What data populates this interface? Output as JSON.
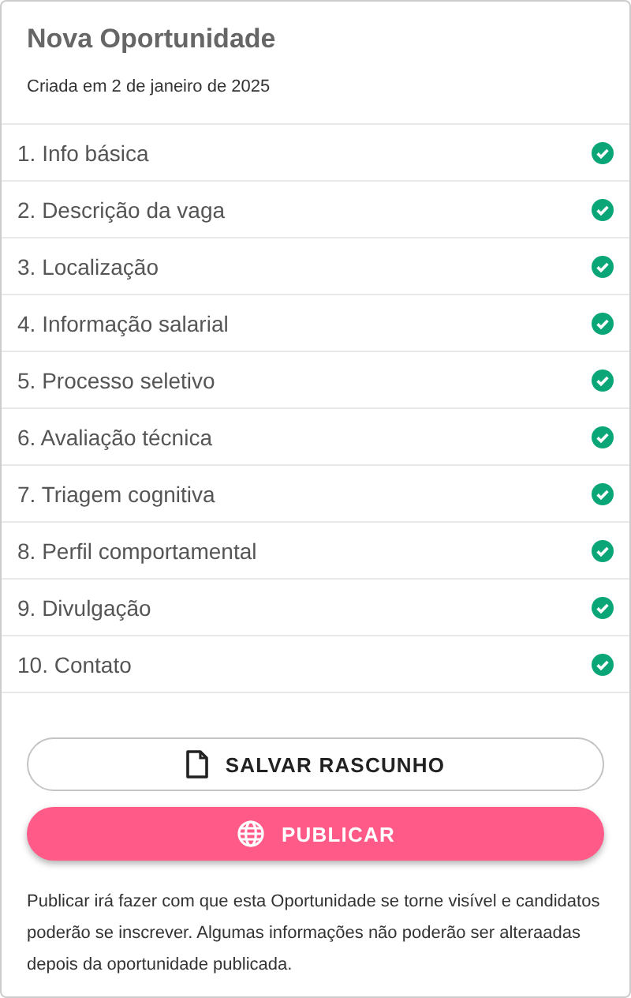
{
  "header": {
    "title": "Nova Oportunidade",
    "subtitle": "Criada em 2 de janeiro de 2025"
  },
  "steps": [
    {
      "label": "1. Info básica",
      "completed": true
    },
    {
      "label": "2. Descrição da vaga",
      "completed": true
    },
    {
      "label": "3. Localização",
      "completed": true
    },
    {
      "label": "4. Informação salarial",
      "completed": true
    },
    {
      "label": "5. Processo seletivo",
      "completed": true
    },
    {
      "label": "6. Avaliação técnica",
      "completed": true
    },
    {
      "label": "7. Triagem cognitiva",
      "completed": true
    },
    {
      "label": "8. Perfil comportamental",
      "completed": true
    },
    {
      "label": "9. Divulgação",
      "completed": true
    },
    {
      "label": "10. Contato",
      "completed": true
    }
  ],
  "actions": [
    {
      "label": "SALVAR RASCUNHO",
      "kind": "outlined"
    },
    {
      "label": "PUBLICAR",
      "kind": "filled"
    }
  ],
  "note": "Publicar irá fazer com que esta Oportunidade se torne visível e candidatos poderão se inscrever. Algumas informações não poderão ser alteraadas depois da oportunidade publicada."
}
